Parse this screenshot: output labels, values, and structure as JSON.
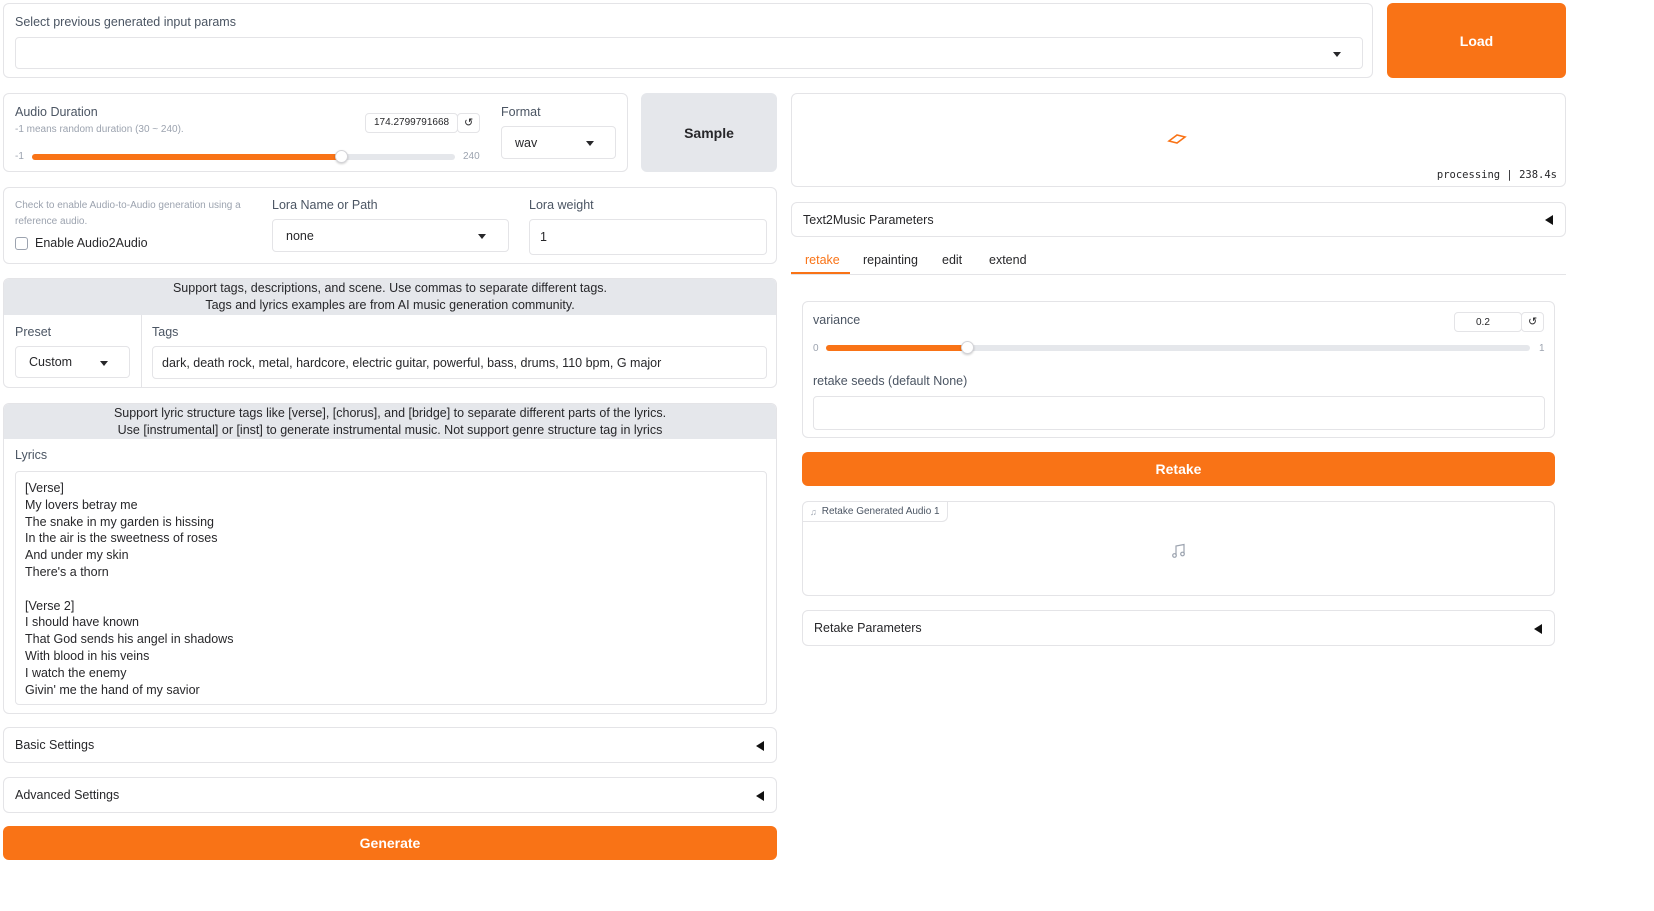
{
  "params_select": {
    "label": "Select previous generated input params",
    "value": ""
  },
  "load_button": "Load",
  "audio_duration": {
    "label": "Audio Duration",
    "hint": "-1 means random duration (30 ~ 240).",
    "value": "174.2799791668",
    "min_label": "-1",
    "max_label": "240",
    "level": 0.73
  },
  "format": {
    "label": "Format",
    "value": "wav"
  },
  "sample_button": "Sample",
  "audio2audio": {
    "hint": "Check to enable Audio-to-Audio generation using a reference audio.",
    "checkbox_label": "Enable Audio2Audio",
    "checked": false
  },
  "lora_name": {
    "label": "Lora Name or Path",
    "value": "none"
  },
  "lora_weight": {
    "label": "Lora weight",
    "value": "1"
  },
  "tags_banner": {
    "line1": "Support tags, descriptions, and scene. Use commas to separate different tags.",
    "line2": "Tags and lyrics examples are from AI music generation community."
  },
  "preset": {
    "label": "Preset",
    "value": "Custom"
  },
  "tags": {
    "label": "Tags",
    "value": "dark, death rock, metal, hardcore, electric guitar, powerful, bass, drums, 110 bpm, G major"
  },
  "lyrics_banner": {
    "line1": "Support lyric structure tags like [verse], [chorus], and [bridge] to separate different parts of the lyrics.",
    "line2": "Use [instrumental] or [inst] to generate instrumental music. Not support genre structure tag in lyrics"
  },
  "lyrics": {
    "label": "Lyrics",
    "lines": [
      "[Verse]",
      "My lovers betray me",
      "The snake in my garden is hissing",
      "In the air is the sweetness of roses",
      "And under my skin",
      "There's a thorn",
      "",
      "[Verse 2]",
      "I should have known",
      "That God sends his angel in shadows",
      "With blood in his veins",
      "I watch the enemy",
      "Givin' me the hand of my savior"
    ]
  },
  "basic_settings": "Basic Settings",
  "advanced_settings": "Advanced Settings",
  "generate_button": "Generate",
  "status": {
    "text": "processing | 238.4s",
    "color": "#f97316"
  },
  "text2music_params": "Text2Music Parameters",
  "tabs": [
    "retake",
    "repainting",
    "edit",
    "extend"
  ],
  "active_tab": "retake",
  "variance": {
    "label": "variance",
    "value": "0.2",
    "min_label": "0",
    "max_label": "1",
    "level": 0.2
  },
  "retake_seeds": {
    "label": "retake seeds (default None)",
    "value": ""
  },
  "retake_button": "Retake",
  "retake_audio": {
    "label": "Retake Generated Audio 1"
  },
  "retake_params": "Retake Parameters",
  "colors": {
    "accent": "#f97316",
    "border": "#e4e4e7",
    "banner": "#e5e7eb"
  }
}
